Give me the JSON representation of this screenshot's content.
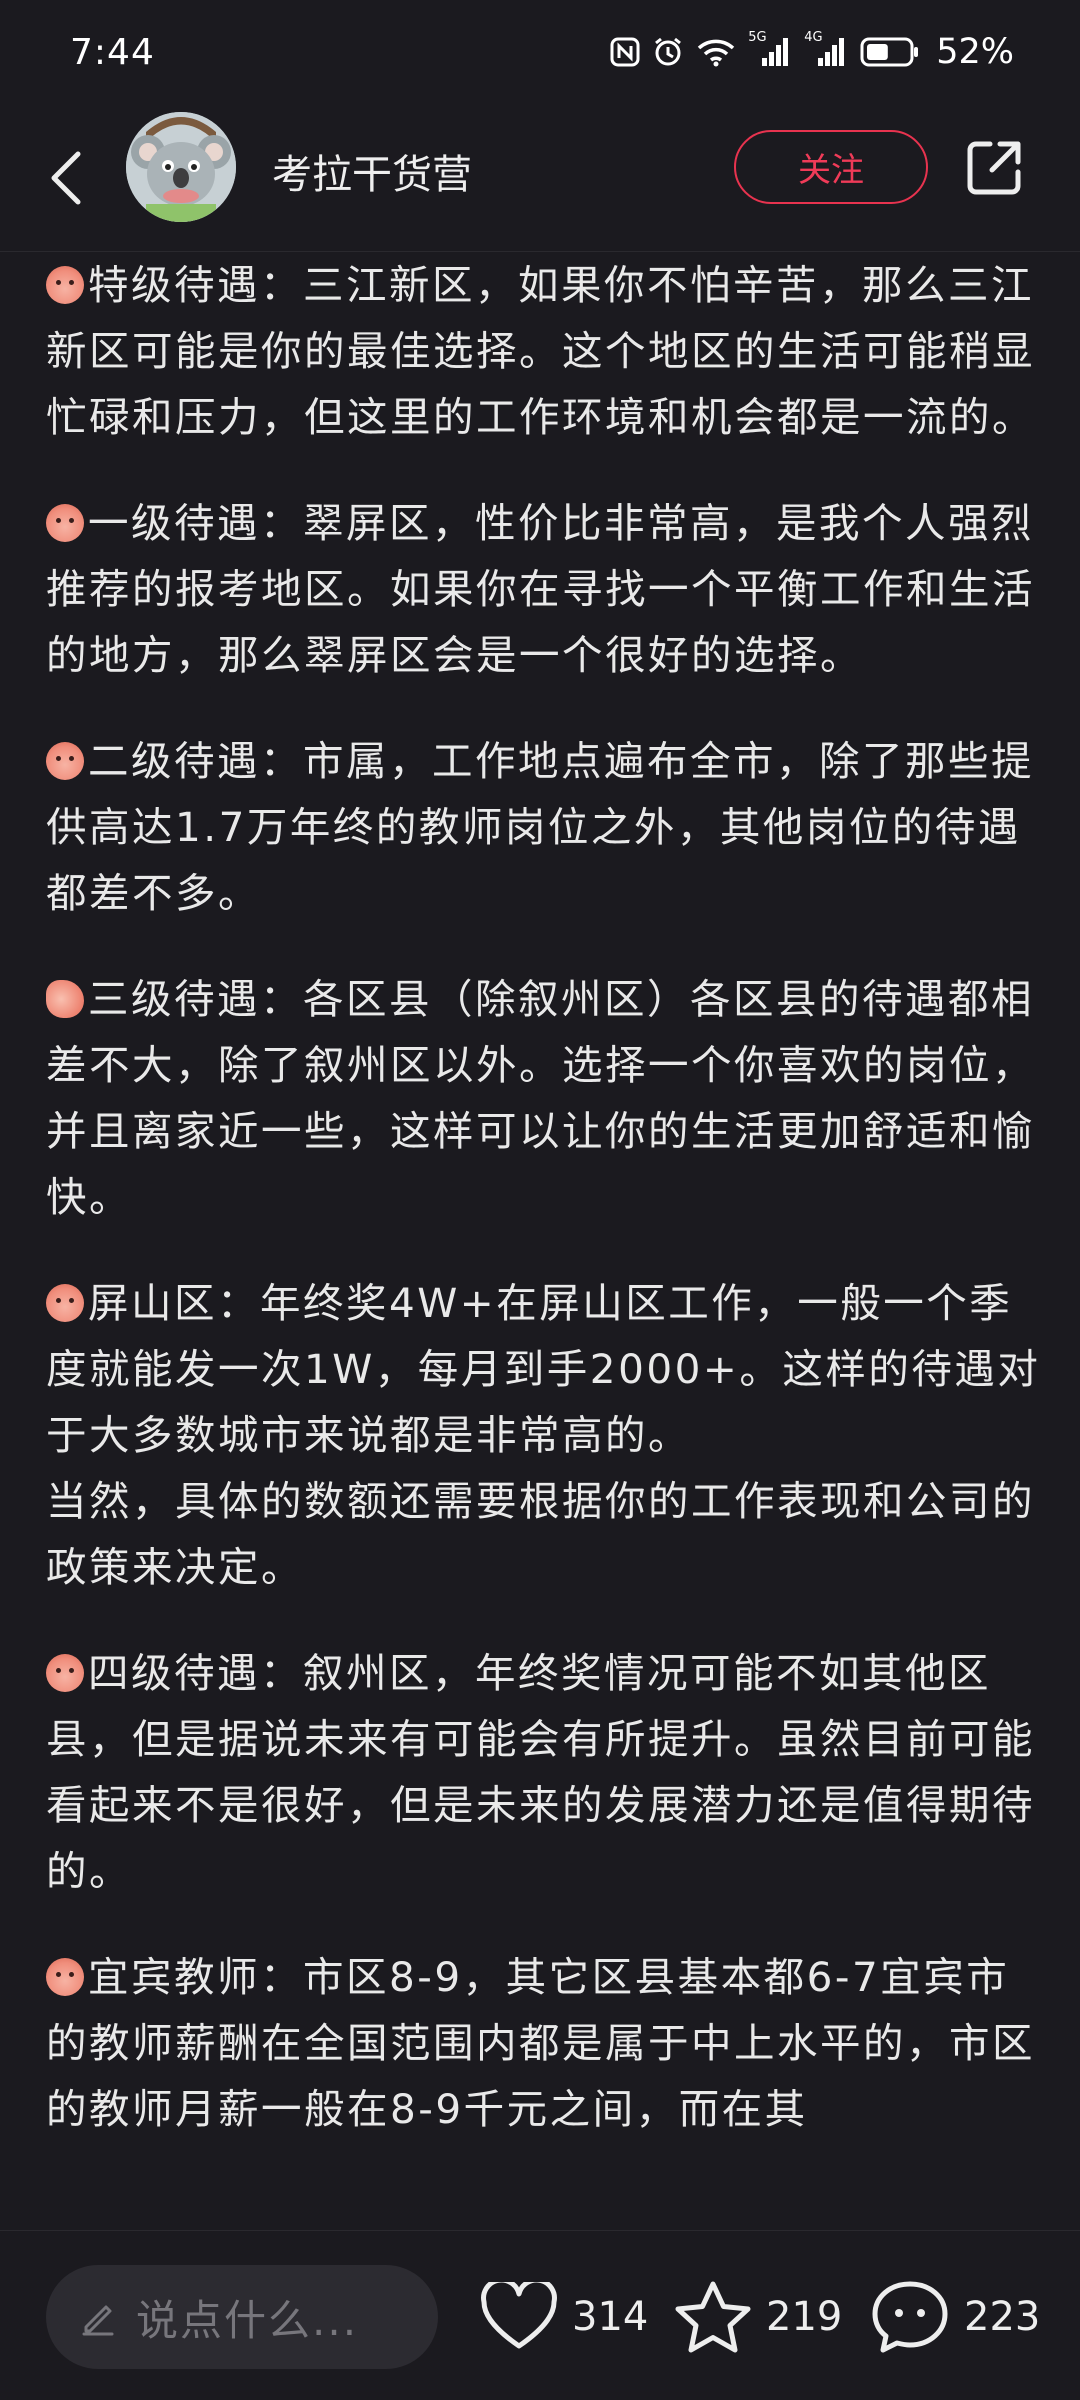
{
  "status_bar": {
    "time": "7:44",
    "network_label": "5G",
    "network2_label": "4G",
    "battery_percent": "52%",
    "battery_level": 0.52
  },
  "header": {
    "account_name": "考拉干货营",
    "follow_label": "关注"
  },
  "content": {
    "paragraphs": [
      "特级待遇：三江新区，如果你不怕辛苦，那么三江新区可能是你的最佳选择。这个地区的生活可能稍显忙碌和压力，但这里的工作环境和机会都是一流的。",
      "一级待遇：翠屏区，性价比非常高，是我个人强烈推荐的报考地区。如果你在寻找一个平衡工作和生活的地方，那么翠屏区会是一个很好的选择。",
      "二级待遇：市属，工作地点遍布全市，除了那些提供高达1.7万年终的教师岗位之外，其他岗位的待遇都差不多。",
      "三级待遇：各区县（除叙州区）各区县的待遇都相差不大，除了叙州区以外。选择一个你喜欢的岗位，并且离家近一些，这样可以让你的生活更加舒适和愉快。",
      "屏山区：年终奖4W+在屏山区工作，一般一个季度就能发一次1W，每月到手2000+。这样的待遇对于大多数城市来说都是非常高的。",
      "当然，具体的数额还需要根据你的工作表现和公司的政策来决定。",
      "四级待遇：叙州区，年终奖情况可能不如其他区县，但是据说未来有可能会有所提升。虽然目前可能看起来不是很好，但是未来的发展潜力还是值得期待的。",
      "宜宾教师：市区8-9，其它区县基本都6-7宜宾市的教师薪酬在全国范围内都是属于中上水平的，市区的教师月薪一般在8-9千元之间，而在其"
    ]
  },
  "bottom_bar": {
    "comment_placeholder": "说点什么...",
    "like_count": "314",
    "star_count": "219",
    "comment_count": "223"
  },
  "colors": {
    "background": "#1b1a1f",
    "accent": "#f03b58",
    "text": "#e9e9e9"
  }
}
